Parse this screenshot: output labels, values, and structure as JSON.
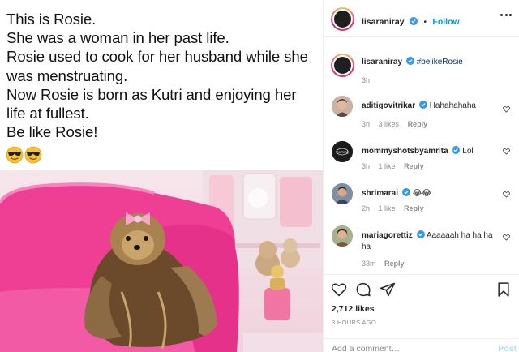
{
  "post": {
    "caption_lines": [
      "This is Rosie.",
      "She was a woman in her past life.",
      "Rosie used to cook for her husband while she",
      "was menstruating.",
      "Now Rosie is born as Kutri and enjoying her",
      "life at fullest.",
      "Be like Rosie!"
    ],
    "emojis": [
      "sunglasses-emoji",
      "sunglasses-emoji"
    ]
  },
  "header": {
    "username": "lisaraniray",
    "separator": "•",
    "follow_label": "Follow",
    "verified": true
  },
  "owner_comment": {
    "username": "lisaraniray",
    "text": "#belikeRosie",
    "time": "3h"
  },
  "comments": [
    {
      "username": "aditigovitrikar",
      "text": "Hahahahaha",
      "time": "3h",
      "likes": "3 likes",
      "reply": "Reply",
      "verified": true
    },
    {
      "username": "mommyshotsbyamrita",
      "text": "Lol",
      "time": "3h",
      "likes": "1 like",
      "reply": "Reply",
      "verified": true
    },
    {
      "username": "shrimarai",
      "text": "😂😂",
      "time": "2h",
      "likes": "1 like",
      "reply": "Reply",
      "verified": true
    },
    {
      "username": "mariagorettiz",
      "text": "Aaaaaah ha ha ha ha",
      "time": "33m",
      "likes": "",
      "reply": "Reply",
      "verified": true
    }
  ],
  "actions": {
    "likes": "2,712 likes",
    "timestamp": "3 HOURS AGO",
    "comment_placeholder": "Add a comment…",
    "post_label": "Post"
  },
  "colors": {
    "accent": "#0095f6",
    "verified": "#3897f0",
    "hashtag": "#00376b",
    "muted": "#8e8e8e"
  }
}
